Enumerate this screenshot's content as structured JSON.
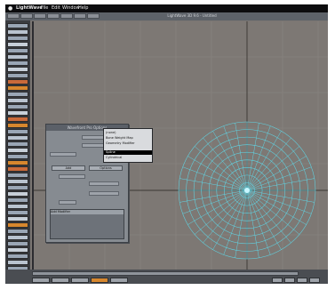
{
  "menubar": {
    "app_name": "LightWave",
    "items": [
      "File",
      "Edit",
      "Window",
      "Help"
    ]
  },
  "titlestrip": {
    "document": "LightWave 3D 9.6 - Untitled"
  },
  "dialog": {
    "title": "Wavefront Pro Options",
    "button_add": "Add",
    "button_options": "Options",
    "list_header": "Add Modifier"
  },
  "dropdown": {
    "items": [
      "(none)",
      "Bone Weight Map",
      "Geometry Modifier",
      "Spline",
      "Cylindrical"
    ]
  },
  "colors": {
    "wireframe": "#5fd6e6",
    "viewport_bg": "#7d7874",
    "highlight": "#000000",
    "toolbar_orange": "#d7872e"
  }
}
